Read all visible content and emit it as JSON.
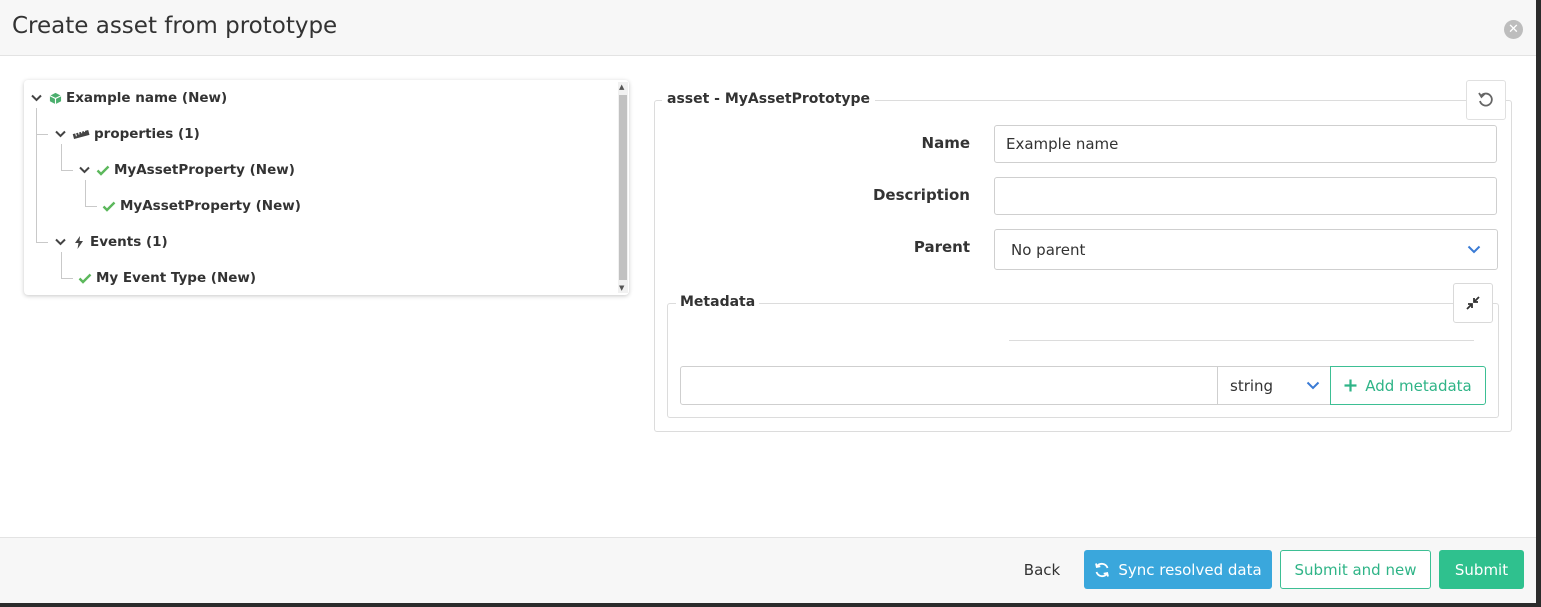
{
  "dialog": {
    "title": "Create asset from prototype"
  },
  "tree": {
    "items": [
      {
        "label": "Example name (New)",
        "icon": "cube-icon"
      },
      {
        "label": "properties (1)",
        "icon": "ruler-icon"
      },
      {
        "label": "MyAssetProperty (New)",
        "icon": "check-icon"
      },
      {
        "label": "MyAssetProperty (New)",
        "icon": "check-icon"
      },
      {
        "label": "Events (1)",
        "icon": "bolt-icon"
      },
      {
        "label": "My Event Type (New)",
        "icon": "check-icon"
      }
    ]
  },
  "form": {
    "legend": "asset - MyAssetPrototype",
    "name_label": "Name",
    "name_value": "Example name",
    "description_label": "Description",
    "description_value": "",
    "parent_label": "Parent",
    "parent_value": "No parent"
  },
  "metadata": {
    "legend": "Metadata",
    "key_value": "",
    "type_value": "string",
    "add_label": "Add metadata"
  },
  "footer": {
    "back_label": "Back",
    "sync_label": "Sync resolved data",
    "submit_new_label": "Submit and new",
    "submit_label": "Submit"
  },
  "colors": {
    "accent_green": "#2fc18e",
    "accent_blue": "#3aa7dc",
    "check_green": "#5cb85c"
  }
}
